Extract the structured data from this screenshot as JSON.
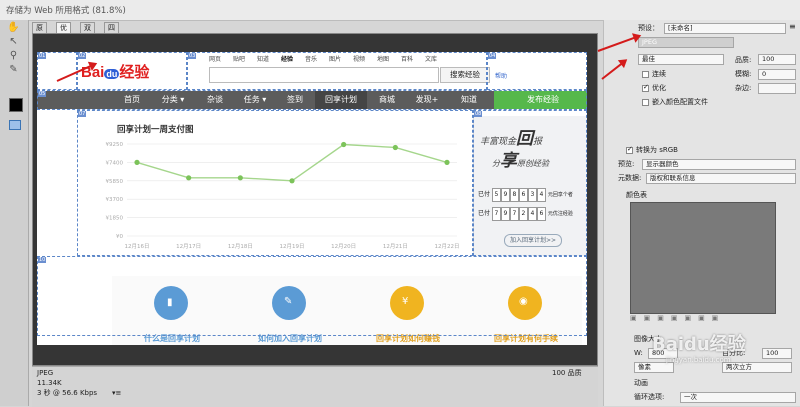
{
  "window": {
    "title": "存储为 Web 所用格式 (81.8%)"
  },
  "tabs": [
    "原稿",
    "优化",
    "双联",
    "四联"
  ],
  "page": {
    "top_links": [
      "网页",
      "贴吧",
      "知道",
      "经验",
      "音乐",
      "图片",
      "视频",
      "地图",
      "百科",
      "文库"
    ],
    "logo_text": "Bai",
    "logo_paw": "du",
    "logo_cn": "经验",
    "search_button": "搜索经验",
    "help_link": "帮助",
    "nav": [
      "首页",
      "分类 ▾",
      "杂谈",
      "任务 ▾",
      "签到",
      "回享计划",
      "商城",
      "发现+",
      "知道"
    ],
    "publish_button": "发布经验",
    "chart_title": "回享计划一周支付图",
    "side_banner": {
      "line1": "丰富现金",
      "big1": "回",
      "line1b": "报",
      "line2": "分",
      "big2": "享",
      "line2b": "原创经验"
    },
    "stats": {
      "row1_label": "已付",
      "row1_digits": [
        "5",
        "9",
        "8",
        "6",
        "3",
        "4"
      ],
      "row1_suffix": "元回享个者",
      "row2_label": "已付",
      "row2_digits": [
        "7",
        "9",
        "7",
        "2",
        "4",
        "6"
      ],
      "row2_suffix": "元优注经验"
    },
    "join_button": "加入回享计划>>",
    "steps": [
      "什么是回享计划",
      "如何加入回享计划",
      "回享计划如何赚钱",
      "回享计划有何手续"
    ]
  },
  "chart_data": {
    "type": "line",
    "title": "回享计划一周支付图",
    "categories": [
      "12月16日",
      "12月17日",
      "12月18日",
      "12月19日",
      "12月20日",
      "12月21日",
      "12月22日"
    ],
    "series": [
      {
        "values": [
          7400,
          5850,
          5850,
          5550,
          9200,
          8900,
          7400
        ]
      }
    ],
    "y_ticks": [
      "¥9250",
      "¥7400",
      "¥5850",
      "¥3700",
      "¥1850",
      "¥0"
    ],
    "ylim": [
      0,
      9250
    ],
    "grid": true,
    "colors": {
      "line": "#a5d68c",
      "point": "#7cc35a"
    }
  },
  "info": {
    "format": "JPEG",
    "size": "11.34K",
    "time": "3 秒 @ 56.6 Kbps",
    "menu": "▾≡",
    "quality": "100 品质"
  },
  "panel": {
    "preset_label": "预设：",
    "preset_value": "[未命名]",
    "format_value": "JPEG",
    "quality_preset": "最佳",
    "quality_label": "品质:",
    "quality_value": "100",
    "progressive_label": "连续",
    "blur_label": "模糊:",
    "blur_value": "0",
    "optimized_label": "优化",
    "matte_label": "杂边:",
    "embed_profile_label": "嵌入颜色配置文件",
    "srgb_label": "转换为 sRGB",
    "preview_label": "预览:",
    "preview_value": "显示器颜色",
    "metadata_label": "元数据:",
    "metadata_value": "版权和联系信息",
    "color_table_label": "颜色表",
    "image_size_label": "图像大小",
    "w_label": "W:",
    "w_value": "800",
    "percent_label": "百分比:",
    "percent_value": "100",
    "pixel_label": "像素",
    "quality_method": "两次立方",
    "anim_label": "动画",
    "loop_label": "循环选项:",
    "loop_value": "一次"
  },
  "watermark": {
    "text": "Baidu经验",
    "sub": "jingyan.baidu.com"
  }
}
